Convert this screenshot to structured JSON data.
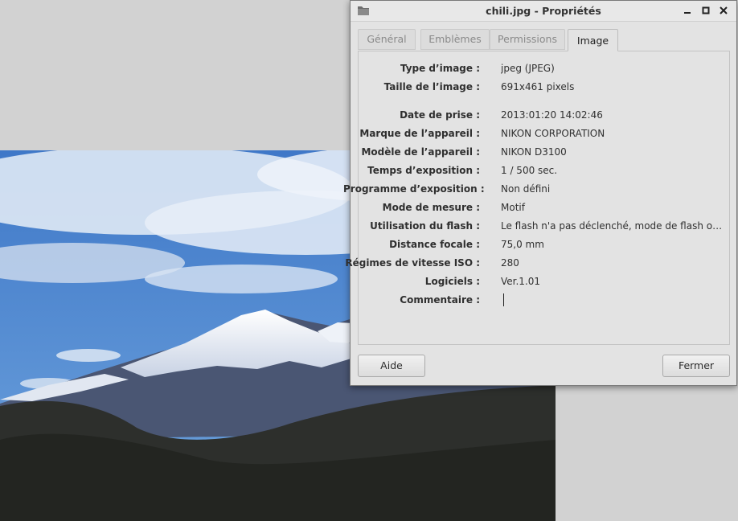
{
  "window": {
    "title": "chili.jpg - Propriétés"
  },
  "tabs": [
    {
      "label": "Général",
      "active": false
    },
    {
      "label": "Emblèmes",
      "active": false
    },
    {
      "label": "Permissions",
      "active": false
    },
    {
      "label": "Image",
      "active": true
    }
  ],
  "properties": [
    {
      "label": "Type d’image :",
      "value": "jpeg (JPEG)"
    },
    {
      "label": "Taille de l’image :",
      "value": "691x461 pixels"
    },
    {
      "label": "Date de prise :",
      "value": "2013:01:20 14:02:46"
    },
    {
      "label": "Marque de l’appareil :",
      "value": "NIKON CORPORATION"
    },
    {
      "label": "Modèle de l’appareil :",
      "value": "NIKON D3100"
    },
    {
      "label": "Temps d’exposition :",
      "value": "1 / 500 sec."
    },
    {
      "label": "Programme d’exposition :",
      "value": "Non défini"
    },
    {
      "label": "Mode de mesure :",
      "value": "Motif"
    },
    {
      "label": "Utilisation du flash :",
      "value": "Le flash n'a pas déclenché, mode de flash obligatoire"
    },
    {
      "label": "Distance focale :",
      "value": "75,0 mm"
    },
    {
      "label": "Régimes de vitesse ISO :",
      "value": "280"
    },
    {
      "label": "Logiciels :",
      "value": "Ver.1.01"
    }
  ],
  "comment": {
    "label": "Commentaire :",
    "value": ""
  },
  "buttons": {
    "help": "Aide",
    "close": "Fermer"
  },
  "icons": {
    "app": "folder-icon",
    "minimize": "minimize-icon",
    "maximize": "maximize-icon",
    "close": "close-icon"
  }
}
